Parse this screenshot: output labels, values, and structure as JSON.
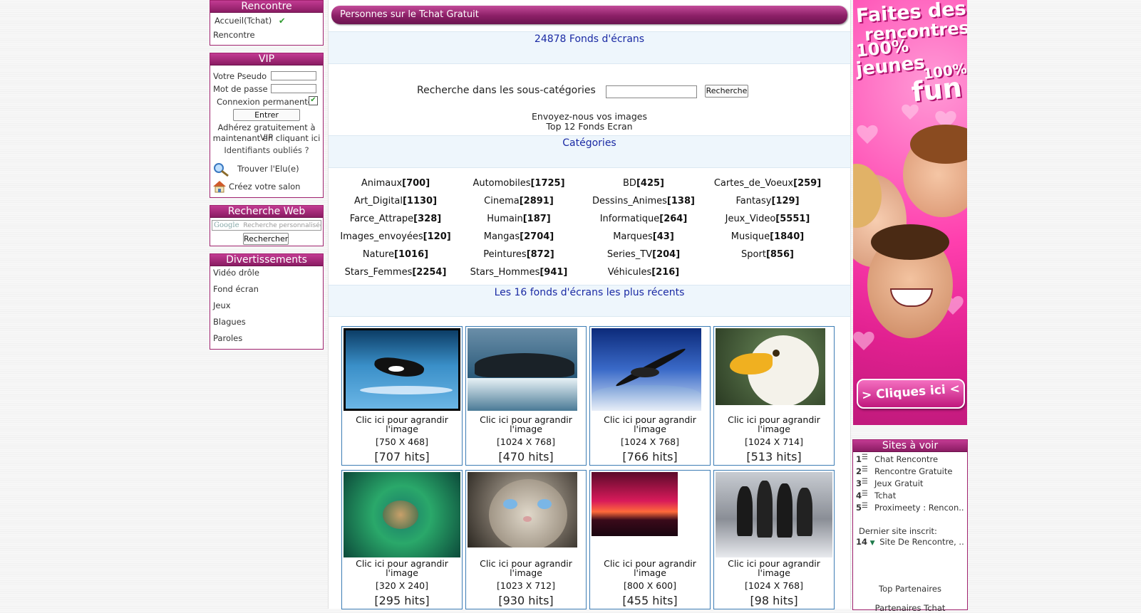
{
  "left": {
    "rencontre": {
      "title": "Rencontre",
      "items": [
        "Accueil(Tchat)",
        "Rencontre"
      ]
    },
    "vip": {
      "title": "VIP",
      "pseudo_label": "Votre Pseudo",
      "password_label": "Mot de passe",
      "permanent_label": "Connexion permanente",
      "submit_label": "Entrer",
      "join_line1": "Adhérez gratuitement à  VIP",
      "join_line2": "maintenant en cliquant ici",
      "forgot": "Identifiants oubliés ?",
      "find": "Trouver l'Elu(e)",
      "create": "Créez votre salon"
    },
    "search": {
      "title": "Recherche Web",
      "placeholder": "Recherche personnalisée",
      "button": "Rechercher"
    },
    "fun": {
      "title": "Divertissements",
      "items": [
        "Vidéo drôle",
        "Fond écran",
        "Jeux",
        "Blagues",
        "Paroles"
      ]
    }
  },
  "center": {
    "header_bar": "Personnes sur le Tchat Gratuit",
    "count_title": "24878 Fonds d'écrans",
    "subsearch_label": "Recherche dans les sous-catégories",
    "subsearch_button": "Recherche",
    "send_link": "Envoyez-nous vos images",
    "top_link": "Top 12 Fonds Ecran",
    "categories_title": "Catégories",
    "categories": [
      {
        "name": "Animaux",
        "count": "[700]"
      },
      {
        "name": "Automobiles",
        "count": "[1725]"
      },
      {
        "name": "BD",
        "count": "[425]"
      },
      {
        "name": "Cartes_de_Voeux",
        "count": "[259]"
      },
      {
        "name": "Art_Digital",
        "count": "[1130]"
      },
      {
        "name": "Cinema",
        "count": "[2891]"
      },
      {
        "name": "Dessins_Animes",
        "count": "[138]"
      },
      {
        "name": "Fantasy",
        "count": "[129]"
      },
      {
        "name": "Farce_Attrape",
        "count": "[328]"
      },
      {
        "name": "Humain",
        "count": "[187]"
      },
      {
        "name": "Informatique",
        "count": "[264]"
      },
      {
        "name": "Jeux_Video",
        "count": "[5551]"
      },
      {
        "name": "Images_envoyées",
        "count": "[120]"
      },
      {
        "name": "Mangas",
        "count": "[2704]"
      },
      {
        "name": "Marques",
        "count": "[43]"
      },
      {
        "name": "Musique",
        "count": "[1840]"
      },
      {
        "name": "Nature",
        "count": "[1016]"
      },
      {
        "name": "Peintures",
        "count": "[872]"
      },
      {
        "name": "Series_TV",
        "count": "[204]"
      },
      {
        "name": "Sport",
        "count": "[856]"
      },
      {
        "name": "Stars_Femmes",
        "count": "[2254]"
      },
      {
        "name": "Stars_Hommes",
        "count": "[941]"
      },
      {
        "name": "Véhicules",
        "count": "[216]"
      }
    ],
    "recent_title": "Les 16 fonds d'écrans les plus récents",
    "wallpapers": [
      {
        "caption1": "Clic ici pour agrandir",
        "caption2": "l'image",
        "dims": "[750 X 468]",
        "hits": "[707 hits]"
      },
      {
        "caption1": "Clic ici pour agrandir",
        "caption2": "l'image",
        "dims": "[1024 X 768]",
        "hits": "[470 hits]"
      },
      {
        "caption1": "Clic ici pour agrandir",
        "caption2": "l'image",
        "dims": "[1024 X 768]",
        "hits": "[766 hits]"
      },
      {
        "caption1": "Clic ici pour agrandir",
        "caption2": "l'image",
        "dims": "[1024 X 714]",
        "hits": "[513 hits]"
      },
      {
        "caption1": "Clic ici pour agrandir",
        "caption2": "l'image",
        "dims": "[320 X 240]",
        "hits": "[295 hits]"
      },
      {
        "caption1": "Clic ici pour agrandir",
        "caption2": "l'image",
        "dims": "[1023 X 712]",
        "hits": "[930 hits]"
      },
      {
        "caption1": "Clic ici pour agrandir",
        "caption2": "l'image",
        "dims": "[800 X 600]",
        "hits": "[455 hits]"
      },
      {
        "caption1": "Clic ici pour agrandir",
        "caption2": "l'image",
        "dims": "[1024 X 768]",
        "hits": "[98 hits]"
      }
    ]
  },
  "right": {
    "ad": {
      "line1": "Faites des",
      "line2": "rencontres",
      "line3": "100%",
      "line4": "jeunes",
      "line5": "100%",
      "line6": "fun",
      "cta": "> Cliques ici <"
    },
    "sites": {
      "title": "Sites à voir",
      "items": [
        {
          "num": "1",
          "label": "Chat Rencontre"
        },
        {
          "num": "2",
          "label": "Rencontre Gratuite"
        },
        {
          "num": "3",
          "label": "Jeux Gratuit"
        },
        {
          "num": "4",
          "label": "Tchat"
        },
        {
          "num": "5",
          "label": "Proximeety : Rencon.."
        }
      ],
      "last_label": "Dernier site inscrit:",
      "last_num": "14",
      "last_site": "Site De Rencontre, ..",
      "partners": "Top Partenaires",
      "partners2": "Partenaires Tchat"
    }
  },
  "colors": {
    "brand_magenta": "#a0236f",
    "title_blue": "#1a2aa4",
    "card_border": "#3d7db5"
  }
}
